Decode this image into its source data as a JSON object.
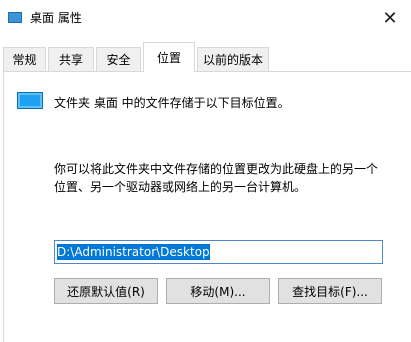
{
  "window": {
    "title": "桌面 属性",
    "close_glyph": "✕"
  },
  "tabs": [
    {
      "label": "常规"
    },
    {
      "label": "共享"
    },
    {
      "label": "安全"
    },
    {
      "label": "位置",
      "active": true
    },
    {
      "label": "以前的版本"
    }
  ],
  "location": {
    "info": "文件夹 桌面 中的文件存储于以下目标位置。",
    "description_line1": "你可以将此文件夹中文件存储的位置更改为此硬盘上的另一个",
    "description_line2": "位置、另一个驱动器或网络上的另一台计算机。",
    "path_value": "D:\\Administrator\\Desktop"
  },
  "buttons": {
    "restore_default": "还原默认值(R)",
    "move": "移动(M)...",
    "find_target": "查找目标(F)..."
  },
  "colors": {
    "accent": "#0078d7",
    "folder_icon": "#1ea1f1",
    "tab_border": "#d9d9d9"
  }
}
